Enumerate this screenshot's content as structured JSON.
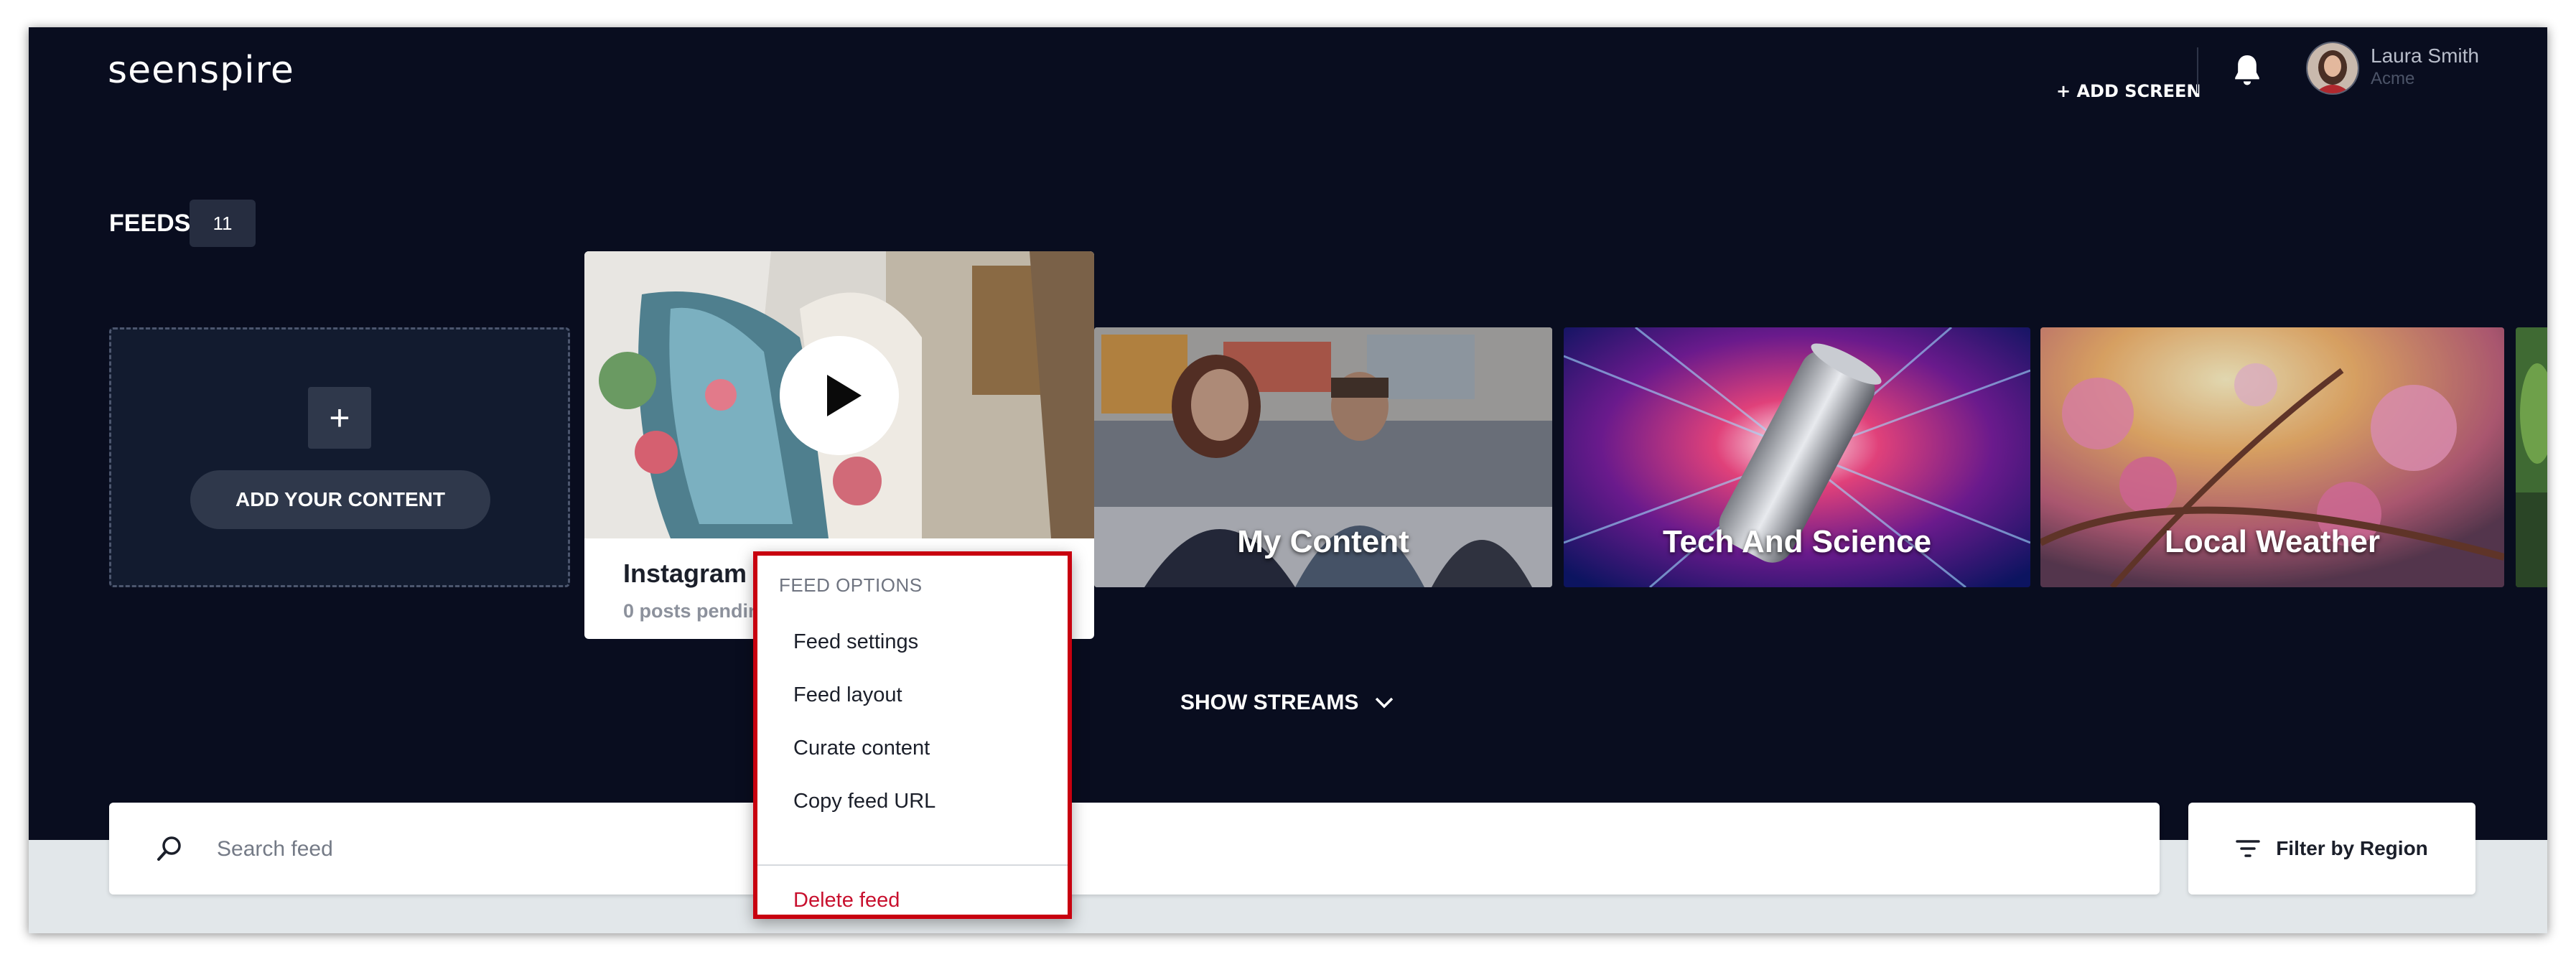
{
  "header": {
    "logo": "seenspire",
    "add_screen": "+ ADD SCREEN",
    "user_name": "Laura Smith",
    "user_org": "Acme"
  },
  "feeds": {
    "title": "FEEDS",
    "count": "11",
    "add_content": {
      "plus": "+",
      "label": "ADD YOUR CONTENT"
    },
    "instagram": {
      "title": "Instagram",
      "subtitle": "0 posts pending"
    },
    "tiles": [
      {
        "label": "My Content"
      },
      {
        "label": "Tech And Science"
      },
      {
        "label": "Local Weather"
      }
    ]
  },
  "show_streams": "SHOW STREAMS",
  "search": {
    "placeholder": "Search feed"
  },
  "filter": {
    "label": "Filter by Region"
  },
  "dropdown": {
    "header": "FEED OPTIONS",
    "items": [
      "Feed settings",
      "Feed layout",
      "Curate content",
      "Copy feed URL"
    ],
    "delete": "Delete feed",
    "highlight_color": "#c8000f"
  },
  "icons": [
    "bell-icon",
    "play-icon",
    "chevron-down-icon",
    "search-icon",
    "filter-icon"
  ]
}
